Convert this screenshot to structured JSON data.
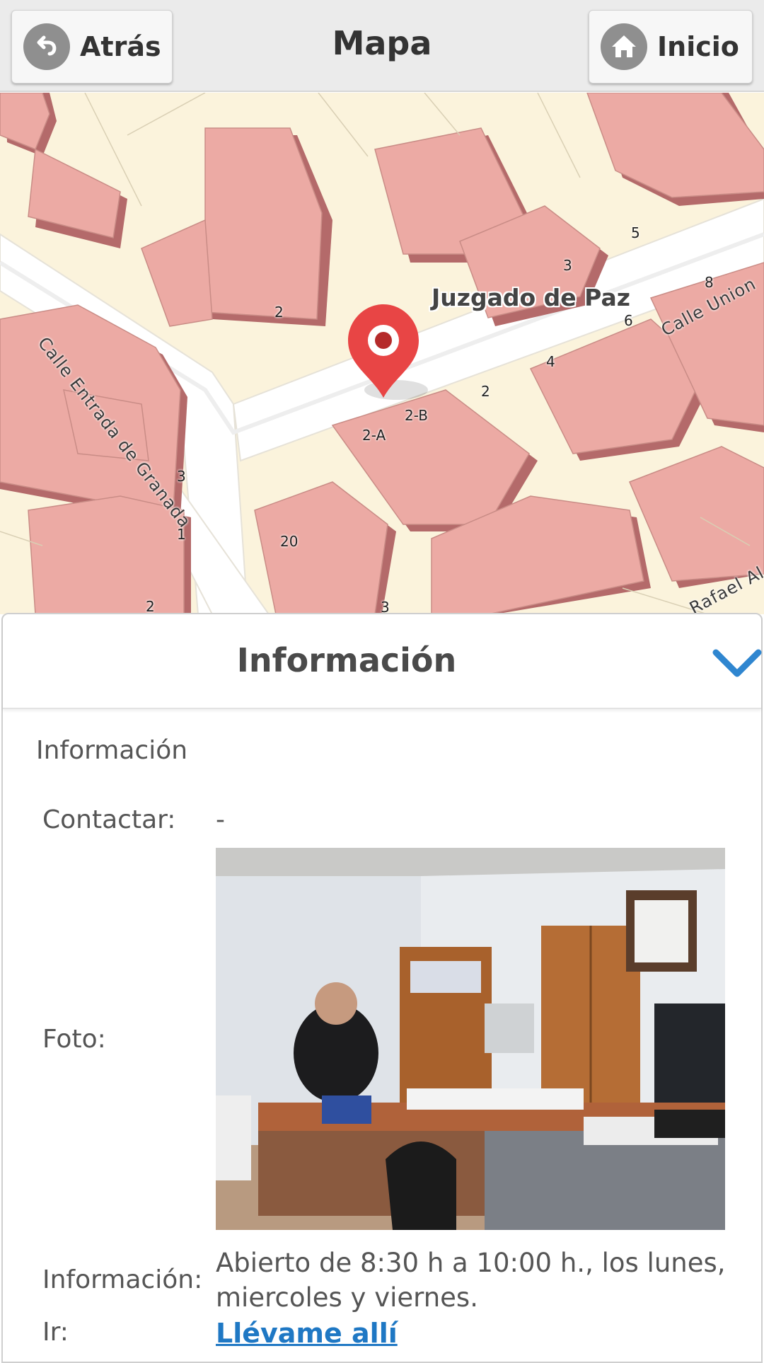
{
  "header": {
    "back_label": "Atrás",
    "title": "Mapa",
    "home_label": "Inicio"
  },
  "map": {
    "poi_label": "Juzgado de Paz",
    "streets": [
      "Calle Entrada de Granada",
      "Calle Union",
      "Rafael Al"
    ],
    "house_numbers": [
      "2",
      "3",
      "5",
      "8",
      "6",
      "4",
      "2",
      "2-B",
      "2-A",
      "20",
      "3",
      "1",
      "2",
      "3"
    ]
  },
  "panel": {
    "title": "Información",
    "section_title": "Información",
    "contact_label": "Contactar:",
    "contact_value": "-",
    "photo_label": "Foto:",
    "info_label": "Información:",
    "info_text": "Abierto de 8:30 h a 10:00 h., los lunes, miercoles y viernes.",
    "go_label": "Ir:",
    "go_link": "Llévame allí"
  },
  "colors": {
    "building": "#ecaaa4",
    "building_shadow": "#b46a6a",
    "land": "#fbf3dc",
    "road": "#ffffff",
    "marker": "#e84545",
    "link": "#1f78c4",
    "chevron": "#2f86d0"
  }
}
